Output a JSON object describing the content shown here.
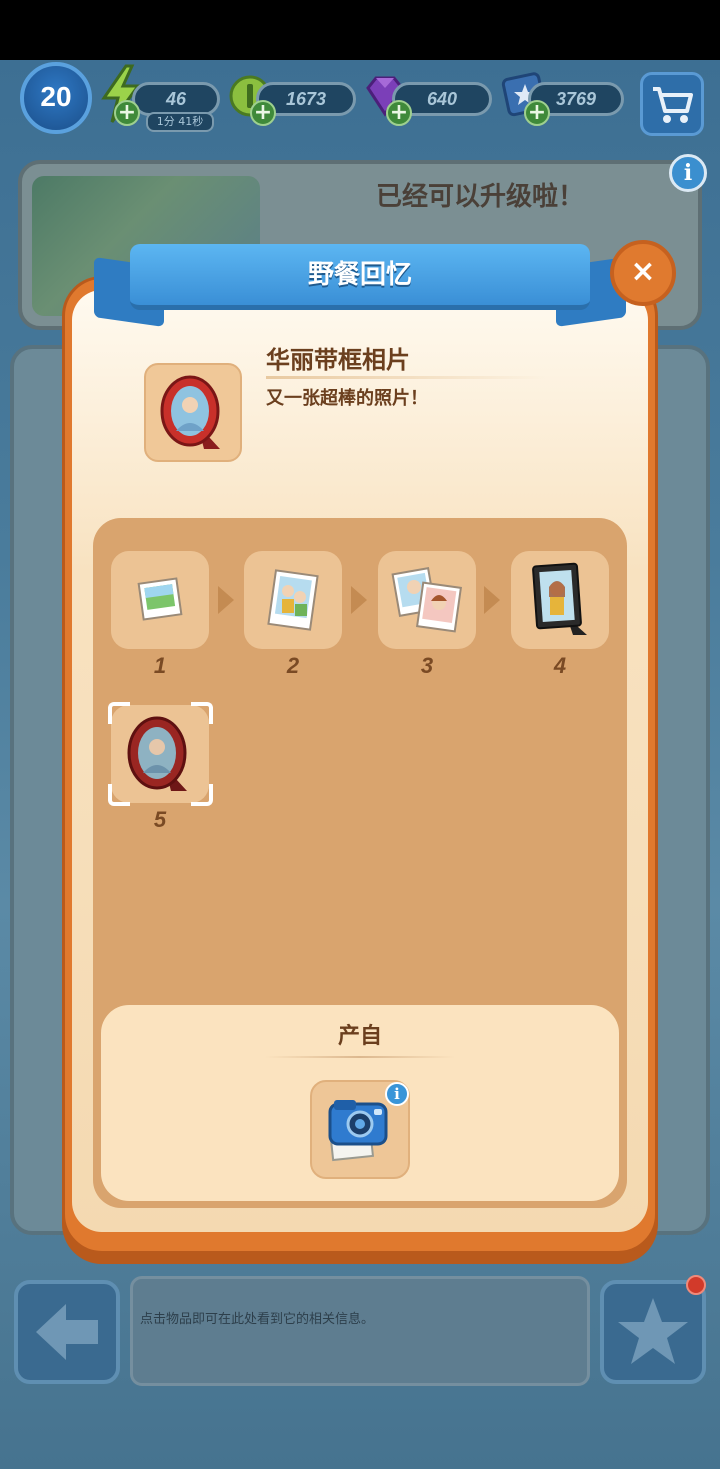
{
  "hud": {
    "level": "20",
    "energy": "46",
    "energy_timer": "1分 41秒",
    "coins": "1673",
    "gems": "640",
    "stars": "3769"
  },
  "background": {
    "upgrade_text": "已经可以升级啦！",
    "hint_text": "点击物品即可在此处看到它的相关信息。"
  },
  "modal": {
    "title": "野餐回忆",
    "item_name": "华丽带框相片",
    "item_desc": "又一张超棒的照片！",
    "chain": [
      {
        "level": "1",
        "icon": "photo-icon"
      },
      {
        "level": "2",
        "icon": "couple-photo-icon"
      },
      {
        "level": "3",
        "icon": "photo-stack-icon"
      },
      {
        "level": "4",
        "icon": "black-frame-photo-icon"
      },
      {
        "level": "5",
        "icon": "round-red-frame-icon",
        "selected": true
      }
    ],
    "source_title": "产自",
    "source_icon": "instant-camera-icon",
    "close_label": "×",
    "info_label": "i"
  },
  "colors": {
    "modal_border": "#e0792e",
    "ribbon": "#3a8fd6",
    "panel": "#d9a46e",
    "text_brown": "#6b3f1e"
  }
}
